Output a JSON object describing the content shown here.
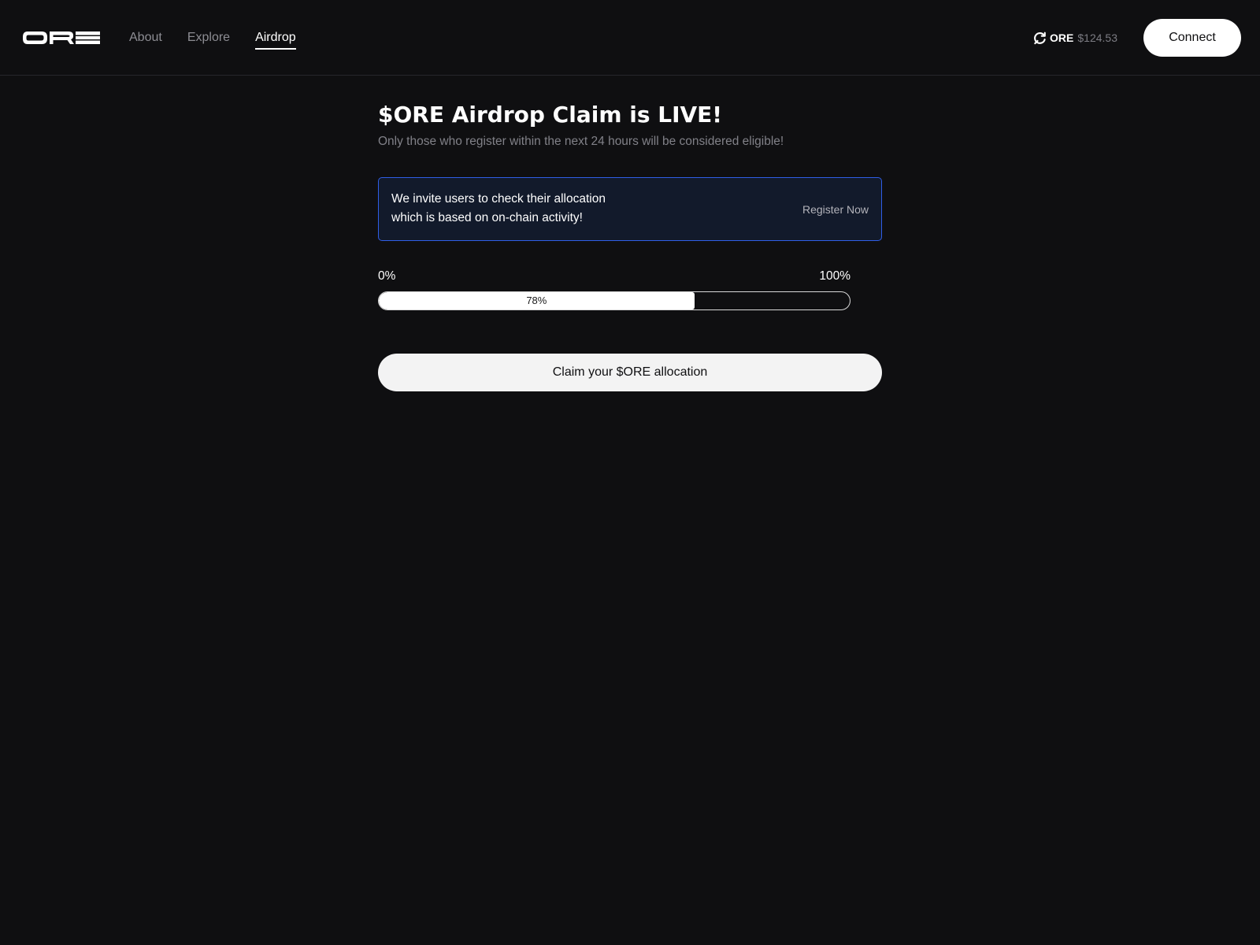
{
  "header": {
    "logo_text": "ORE",
    "nav": [
      {
        "label": "About",
        "active": false
      },
      {
        "label": "Explore",
        "active": false
      },
      {
        "label": "Airdrop",
        "active": true
      }
    ],
    "price": {
      "icon": "refresh-icon",
      "symbol": "ORE",
      "value": "$124.53"
    },
    "connect_label": "Connect"
  },
  "main": {
    "title": "$ORE Airdrop Claim is LIVE!",
    "subtitle": "Only those who register within the next 24 hours will be considered eligible!",
    "notice": {
      "text": "We invite users to check their allocation which is based on on-chain activity!",
      "action_label": "Register Now"
    },
    "progress": {
      "min_label": "0%",
      "max_label": "100%",
      "value_label": "78%",
      "fill_fraction": 0.67
    },
    "claim_label": "Claim your $ORE allocation"
  },
  "colors": {
    "background": "#0f0f11",
    "notice_border": "#2f5ee6",
    "notice_background": "#121a2b",
    "muted_text": "#818188"
  }
}
